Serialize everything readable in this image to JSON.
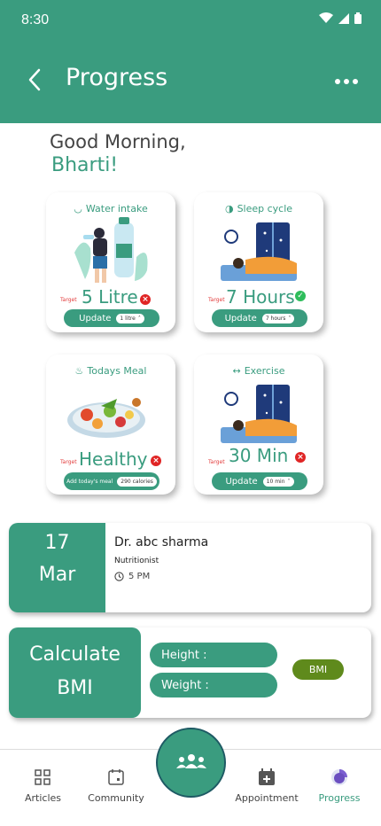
{
  "status_bar": {
    "time": "8:30"
  },
  "header": {
    "title": "Progress"
  },
  "greeting": {
    "line1": "Good Morning,",
    "name": "Bharti!"
  },
  "cards": {
    "water": {
      "title": "Water intake",
      "target_label": "Target",
      "value": "5 Litre",
      "status": "bad",
      "update_label": "Update",
      "pill_value": "1 litre"
    },
    "sleep": {
      "title": "Sleep cycle",
      "target_label": "Target",
      "value": "7 Hours",
      "status": "ok",
      "update_label": "Update",
      "pill_value": "7 hours"
    },
    "meal": {
      "title": "Todays Meal",
      "target_label": "Target",
      "value": "Healthy",
      "status": "bad",
      "update_label": "Add today's meal",
      "pill_value": "290 calories"
    },
    "exercise": {
      "title": "Exercise",
      "target_label": "Target",
      "value": "30 Min",
      "status": "bad",
      "update_label": "Update",
      "pill_value": "10 min"
    }
  },
  "appointment": {
    "day": "17",
    "month": "Mar",
    "doctor": "Dr. abc sharma",
    "role": "Nutritionist",
    "time": "5 PM"
  },
  "bmi": {
    "title_line1": "Calculate",
    "title_line2": "BMI",
    "height_label": "Height :",
    "weight_label": "Weight :",
    "button_label": "BMI"
  },
  "bottom_nav": {
    "articles": "Articles",
    "community": "Community",
    "appointment": "Appointment",
    "progress": "Progress",
    "active": "progress"
  },
  "colors": {
    "primary": "#3a9c7f",
    "bmi_button": "#5f8a1c",
    "target_red": "#e23b3b"
  }
}
